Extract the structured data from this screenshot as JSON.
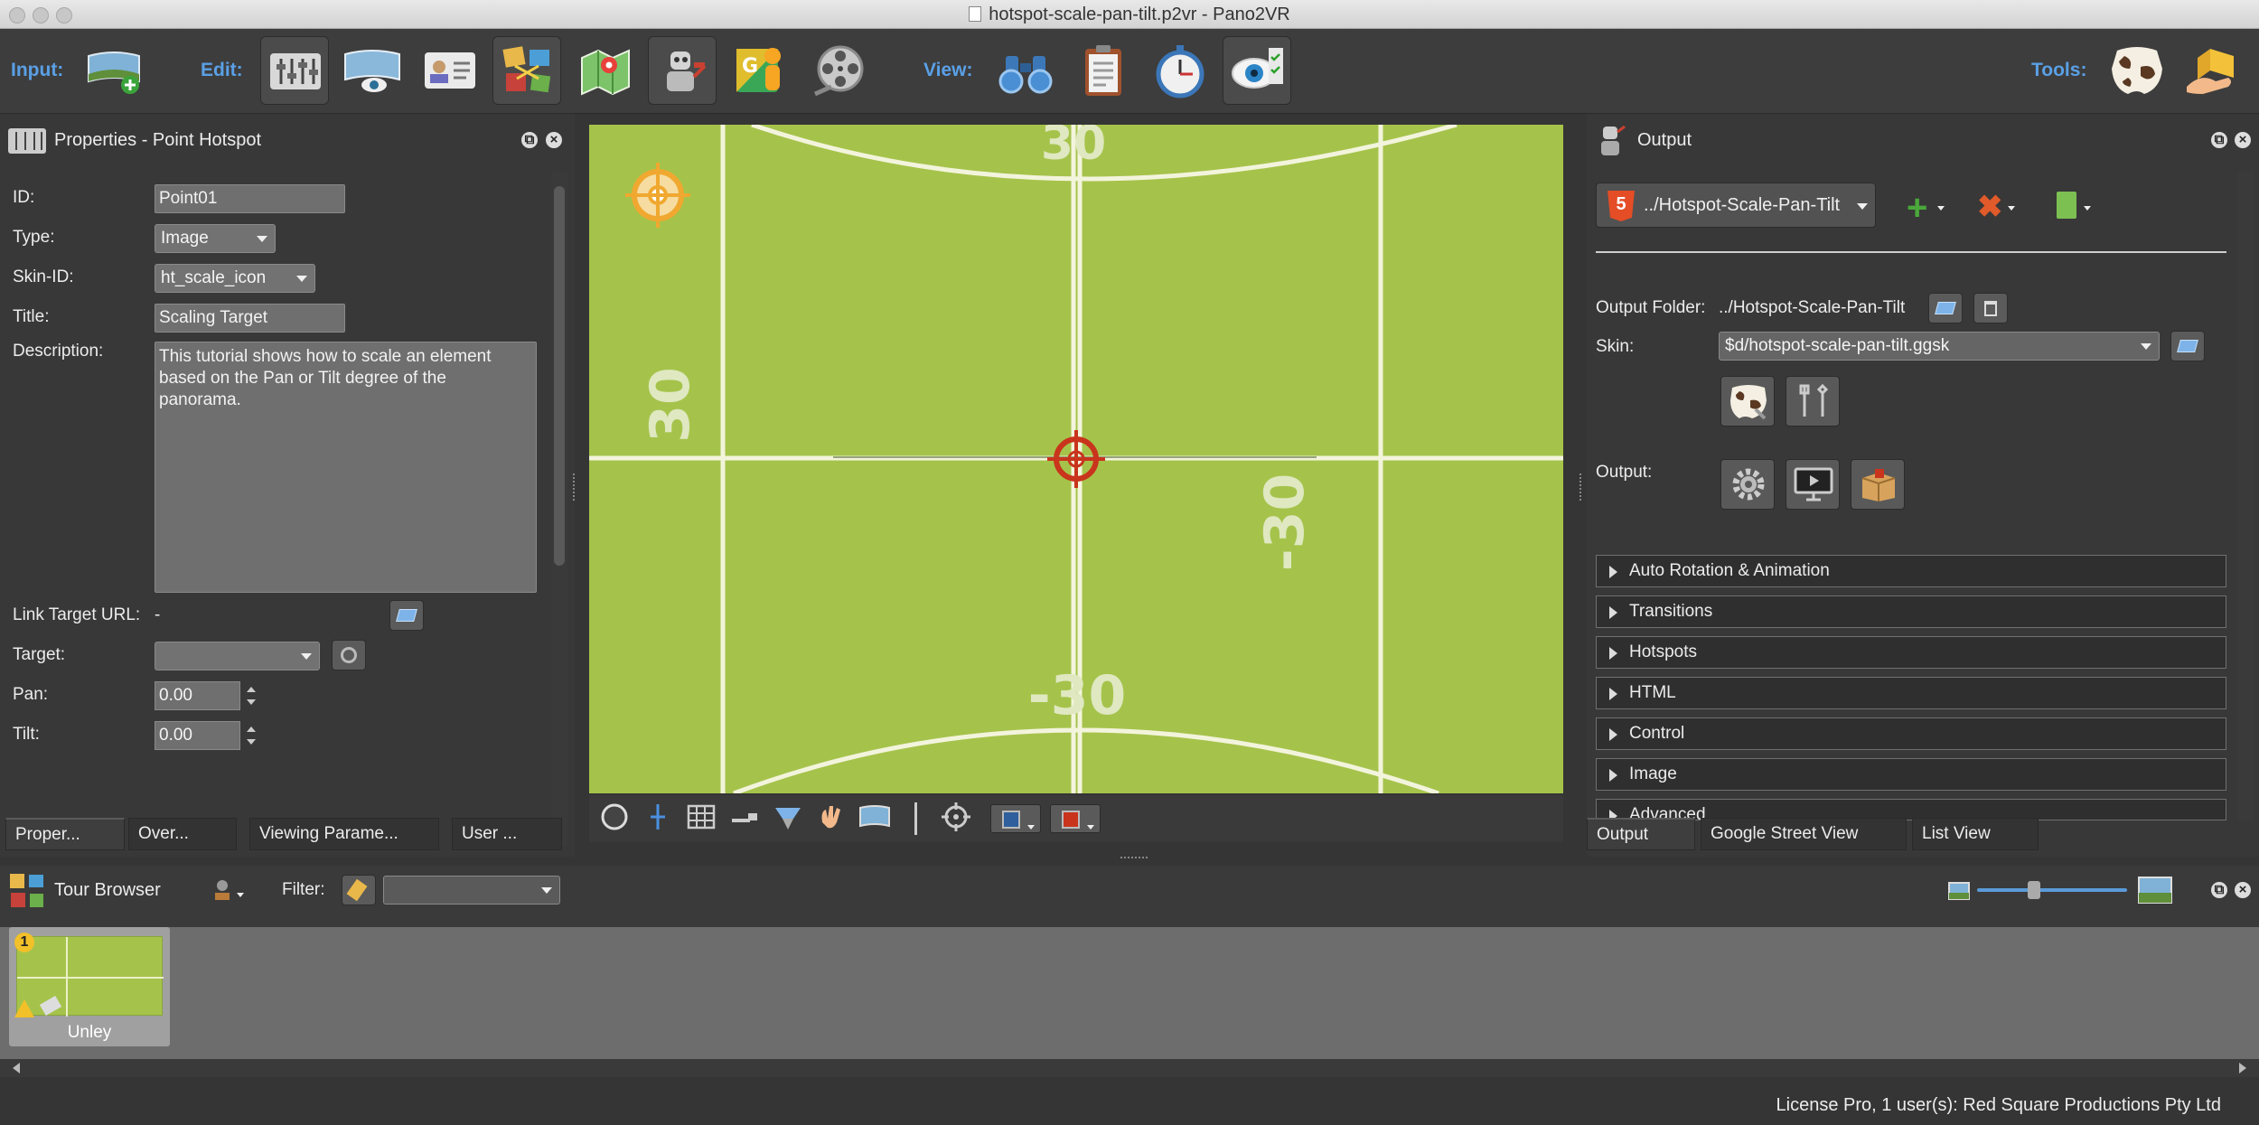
{
  "window": {
    "title": "hotspot-scale-pan-tilt.p2vr - Pano2VR"
  },
  "toolbar": {
    "input_label": "Input:",
    "edit_label": "Edit:",
    "view_label": "View:",
    "tools_label": "Tools:"
  },
  "properties": {
    "title": "Properties - Point Hotspot",
    "id_label": "ID:",
    "id_value": "Point01",
    "type_label": "Type:",
    "type_value": "Image",
    "skin_id_label": "Skin-ID:",
    "skin_id_value": "ht_scale_icon",
    "title_label": "Title:",
    "title_value": "Scaling Target",
    "description_label": "Description:",
    "description_value": "This tutorial shows how to scale an element based on the Pan or Tilt degree of the panorama.",
    "link_label": "Link Target URL:",
    "link_value": "-",
    "target_label": "Target:",
    "target_value": "",
    "pan_label": "Pan:",
    "pan_value": "0.00",
    "tilt_label": "Tilt:",
    "tilt_value": "0.00"
  },
  "left_tabs": [
    "Proper...",
    "Over...",
    "Viewing Parame...",
    "User ..."
  ],
  "viewer": {
    "label_top": "30",
    "label_left": "30",
    "label_right": "-30",
    "label_bottom": "-30"
  },
  "output": {
    "title": "Output",
    "format_value": "../Hotspot-Scale-Pan-Tilt",
    "folder_label": "Output Folder:",
    "folder_value": "../Hotspot-Scale-Pan-Tilt",
    "skin_label": "Skin:",
    "skin_value": "$d/hotspot-scale-pan-tilt.ggsk",
    "output_label": "Output:",
    "sections": [
      "Auto Rotation & Animation",
      "Transitions",
      "Hotspots",
      "HTML",
      "Control",
      "Image",
      "Advanced"
    ]
  },
  "right_tabs": [
    "Output",
    "Google Street View",
    "List View"
  ],
  "tour": {
    "title": "Tour Browser",
    "filter_label": "Filter:",
    "filter_value": "",
    "node_label": "Unley",
    "badge": "1"
  },
  "status": {
    "license": "License Pro, 1 user(s): Red Square Productions Pty Ltd"
  },
  "colors": {
    "accent_blue": "#5aa0e6",
    "grass": "#a5c34b",
    "line": "#f3f4dc",
    "target_red": "#c9341c",
    "target_orange": "#f0a830"
  }
}
